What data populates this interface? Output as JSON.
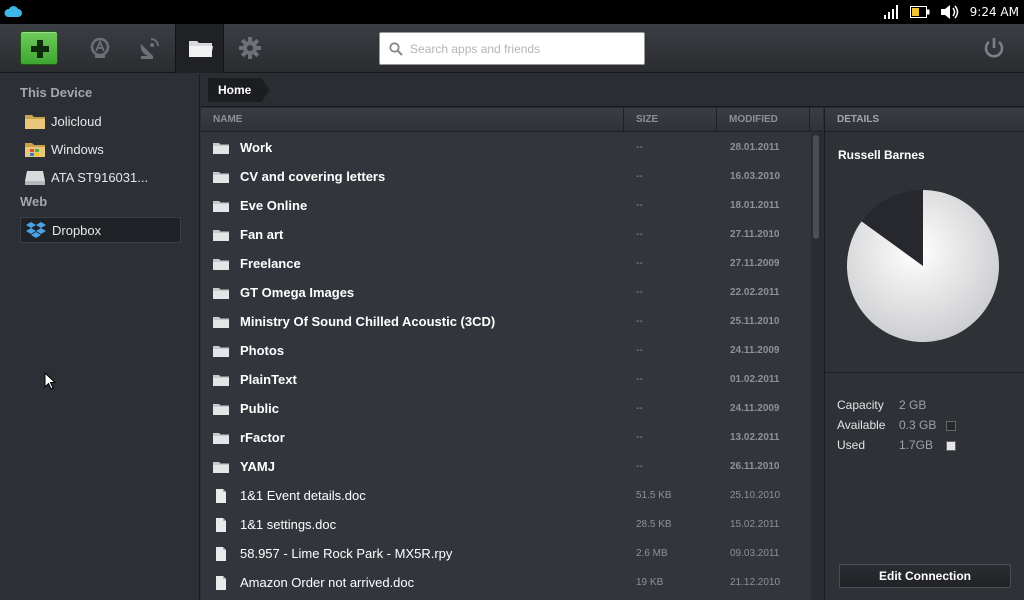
{
  "colors": {
    "accent_green": "#3fa632",
    "bg": "#2b2e33",
    "panel": "#32353b"
  },
  "sysbar": {
    "time": "9:24 AM",
    "icons": [
      "cloud-icon",
      "signal-icon",
      "battery-icon",
      "volume-icon"
    ]
  },
  "search": {
    "placeholder": "Search apps and friends"
  },
  "toolbar": {
    "icons": [
      "add-icon",
      "app-store-icon",
      "satellite-icon",
      "folder-icon",
      "gear-icon",
      "power-icon"
    ]
  },
  "sidebar": {
    "device_heading": "This Device",
    "device_items": [
      {
        "label": "Jolicloud",
        "icon": "drive-folder-icon"
      },
      {
        "label": "Windows",
        "icon": "windows-drive-icon"
      },
      {
        "label": "ATA ST916031...",
        "icon": "hard-disk-icon"
      }
    ],
    "web_heading": "Web",
    "web_items": [
      {
        "label": "Dropbox",
        "icon": "dropbox-icon",
        "selected": true
      }
    ]
  },
  "breadcrumb": {
    "home": "Home"
  },
  "columns": {
    "name": "NAME",
    "size": "SIZE",
    "modified": "MODIFIED"
  },
  "files": [
    {
      "name": "Work",
      "size": "--",
      "modified": "28.01.2011",
      "type": "folder"
    },
    {
      "name": "CV and covering letters",
      "size": "--",
      "modified": "16.03.2010",
      "type": "folder"
    },
    {
      "name": "Eve Online",
      "size": "--",
      "modified": "18.01.2011",
      "type": "folder"
    },
    {
      "name": "Fan art",
      "size": "--",
      "modified": "27.11.2010",
      "type": "folder"
    },
    {
      "name": "Freelance",
      "size": "--",
      "modified": "27.11.2009",
      "type": "folder"
    },
    {
      "name": "GT Omega Images",
      "size": "--",
      "modified": "22.02.2011",
      "type": "folder"
    },
    {
      "name": "Ministry Of Sound Chilled Acoustic (3CD)",
      "size": "--",
      "modified": "25.11.2010",
      "type": "folder"
    },
    {
      "name": "Photos",
      "size": "--",
      "modified": "24.11.2009",
      "type": "folder"
    },
    {
      "name": "PlainText",
      "size": "--",
      "modified": "01.02.2011",
      "type": "folder"
    },
    {
      "name": "Public",
      "size": "--",
      "modified": "24.11.2009",
      "type": "folder"
    },
    {
      "name": "rFactor",
      "size": "--",
      "modified": "13.02.2011",
      "type": "folder"
    },
    {
      "name": "YAMJ",
      "size": "--",
      "modified": "26.11.2010",
      "type": "folder"
    },
    {
      "name": "1&1 Event details.doc",
      "size": "51.5 KB",
      "modified": "25.10.2010",
      "type": "file"
    },
    {
      "name": "1&1 settings.doc",
      "size": "28.5 KB",
      "modified": "15.02.2011",
      "type": "file"
    },
    {
      "name": "58.957 - Lime Rock Park - MX5R.rpy",
      "size": "2.6 MB",
      "modified": "09.03.2011",
      "type": "file"
    },
    {
      "name": "Amazon Order not arrived.doc",
      "size": "19 KB",
      "modified": "21.12.2010",
      "type": "file"
    }
  ],
  "details": {
    "heading": "DETAILS",
    "account": "Russell Barnes",
    "capacity_label": "Capacity",
    "capacity_value": "2 GB",
    "available_label": "Available",
    "available_value": "0.3 GB",
    "used_label": "Used",
    "used_value": "1.7GB",
    "used_fraction": 0.85,
    "available_color": "#26282d",
    "used_color": "#e6e6e6",
    "edit_button": "Edit Connection"
  }
}
